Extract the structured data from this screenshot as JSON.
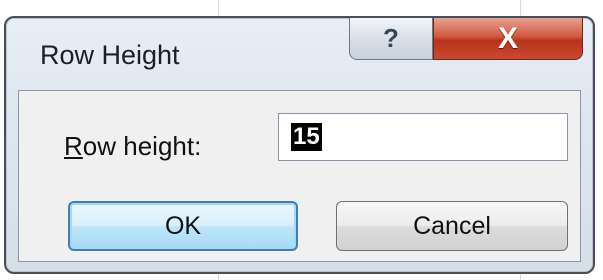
{
  "dialog": {
    "title": "Row Height",
    "help_glyph": "?",
    "close_glyph": "X"
  },
  "form": {
    "label_mnemonic": "R",
    "label_rest": "ow height:",
    "row_height_value": "15"
  },
  "buttons": {
    "ok_label": "OK",
    "cancel_label": "Cancel"
  }
}
